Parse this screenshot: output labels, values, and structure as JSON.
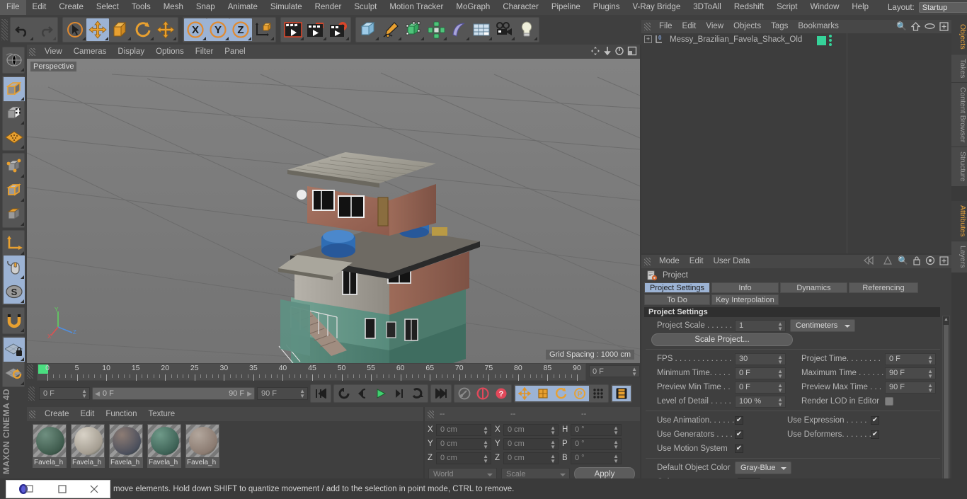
{
  "app": {
    "name": "CINEMA 4D",
    "vendor": "MAXON"
  },
  "menubar": {
    "items": [
      "File",
      "Edit",
      "Create",
      "Select",
      "Tools",
      "Mesh",
      "Snap",
      "Animate",
      "Simulate",
      "Render",
      "Sculpt",
      "Motion Tracker",
      "MoGraph",
      "Character",
      "Pipeline",
      "Plugins",
      "V-Ray Bridge",
      "3DToAll",
      "Redshift",
      "Script",
      "Window",
      "Help"
    ],
    "layout_label": "Layout:",
    "layout_value": "Startup",
    "search_icon": "search-icon"
  },
  "toolbar": {
    "groups": [
      {
        "name": "history",
        "buttons": [
          {
            "icon": "undo-icon",
            "selected": false,
            "disabled": false
          },
          {
            "icon": "redo-icon",
            "selected": false,
            "disabled": true
          }
        ]
      },
      {
        "name": "transform",
        "buttons": [
          {
            "icon": "live-selection-icon",
            "selected": false,
            "disabled": false
          },
          {
            "icon": "move-icon",
            "selected": true,
            "disabled": false
          },
          {
            "icon": "scale-icon",
            "selected": false,
            "disabled": false
          },
          {
            "icon": "rotate-icon",
            "selected": false,
            "disabled": false
          },
          {
            "icon": "move-axis-icon",
            "selected": false,
            "disabled": false
          }
        ]
      },
      {
        "name": "axis-lock",
        "buttons": [
          {
            "icon": "axis-x-icon",
            "selected": true,
            "disabled": false
          },
          {
            "icon": "axis-y-icon",
            "selected": true,
            "disabled": false
          },
          {
            "icon": "axis-z-icon",
            "selected": true,
            "disabled": false
          },
          {
            "icon": "world-coordinates-icon",
            "selected": false,
            "disabled": false
          }
        ]
      },
      {
        "name": "render",
        "buttons": [
          {
            "icon": "render-view-icon",
            "selected": false,
            "disabled": false
          },
          {
            "icon": "render-to-picture-viewer-icon",
            "selected": false,
            "disabled": false
          },
          {
            "icon": "render-settings-icon",
            "selected": false,
            "disabled": false
          }
        ]
      },
      {
        "name": "create",
        "buttons": [
          {
            "icon": "cube-primitive-icon",
            "selected": false,
            "disabled": false
          },
          {
            "icon": "spline-pen-icon",
            "selected": false,
            "disabled": false
          },
          {
            "icon": "generator-nurbs-icon",
            "selected": false,
            "disabled": false
          },
          {
            "icon": "mograph-cloner-icon",
            "selected": false,
            "disabled": false
          },
          {
            "icon": "deformer-bend-icon",
            "selected": false,
            "disabled": false
          },
          {
            "icon": "scene-floor-icon",
            "selected": false,
            "disabled": false
          },
          {
            "icon": "camera-icon",
            "selected": false,
            "disabled": false
          },
          {
            "icon": "light-icon",
            "selected": false,
            "disabled": false
          }
        ]
      }
    ]
  },
  "left_palette": {
    "groups": [
      {
        "buttons": [
          {
            "icon": "undo-view-globe-icon",
            "selected": false
          }
        ]
      },
      {
        "buttons": [
          {
            "icon": "model-mode-icon",
            "selected": true
          },
          {
            "icon": "texture-mode-icon",
            "selected": false
          },
          {
            "icon": "polygon-grid-mode-icon",
            "selected": false
          }
        ]
      },
      {
        "buttons": [
          {
            "icon": "points-mode-icon",
            "selected": false
          },
          {
            "icon": "edges-mode-icon",
            "selected": false
          },
          {
            "icon": "polygons-mode-icon",
            "selected": false
          }
        ]
      },
      {
        "buttons": [
          {
            "icon": "axis-modify-icon",
            "selected": false
          },
          {
            "icon": "viewport-solo-mouse-icon",
            "selected": true
          },
          {
            "icon": "enable-snapping-s-icon",
            "selected": true
          }
        ]
      },
      {
        "buttons": [
          {
            "icon": "magnet-tool-icon",
            "selected": false
          }
        ]
      },
      {
        "buttons": [
          {
            "icon": "workplane-lock-icon",
            "selected": true
          },
          {
            "icon": "workplane-rotate-icon",
            "selected": false
          }
        ]
      }
    ]
  },
  "viewport": {
    "menus": [
      "View",
      "Cameras",
      "Display",
      "Options",
      "Filter",
      "Panel"
    ],
    "label": "Perspective",
    "grid_spacing": "Grid Spacing : 1000 cm",
    "corner_icons": [
      "pan-view-icon",
      "dolly-view-icon",
      "rotate-view-icon",
      "maximize-view-icon"
    ],
    "axis": {
      "x": "X",
      "y": "Y",
      "z": "Z"
    },
    "background_color": "#7c7c7c",
    "grid_line_color": "#6a6a6a"
  },
  "timeline": {
    "ticks": [
      0,
      5,
      10,
      15,
      20,
      25,
      30,
      35,
      40,
      45,
      50,
      55,
      60,
      65,
      70,
      75,
      80,
      85,
      90
    ],
    "current_frame_right": "0 F",
    "current_frame": "0 F",
    "range_start": "0 F",
    "range_end": "90 F",
    "max_frame": "90 F",
    "transport": [
      {
        "icon": "go-to-start-icon",
        "selected": false
      },
      {
        "icon": "play-reverse-loop-icon",
        "selected": false
      },
      {
        "icon": "step-back-icon",
        "selected": false
      },
      {
        "icon": "play-icon",
        "selected": false
      },
      {
        "icon": "step-forward-icon",
        "selected": false
      },
      {
        "icon": "loop-icon",
        "selected": false
      },
      {
        "icon": "go-to-end-icon",
        "selected": false
      }
    ],
    "keyframe_tools": [
      {
        "icon": "record-keyframe-icon",
        "selected": false
      },
      {
        "icon": "autokeying-icon",
        "selected": false
      },
      {
        "icon": "keyframe-selection-icon",
        "selected": false
      }
    ],
    "key_param_toggles": [
      {
        "icon": "key-position-icon",
        "selected": true
      },
      {
        "icon": "key-scale-icon",
        "selected": true
      },
      {
        "icon": "key-rotation-icon",
        "selected": true
      },
      {
        "icon": "key-parameter-p-icon",
        "selected": true
      },
      {
        "icon": "key-pla-points-icon",
        "selected": false
      }
    ],
    "filmstrip": {
      "icon": "timeline-filmstrip-icon",
      "selected": true
    }
  },
  "materials": {
    "menus": [
      "Create",
      "Edit",
      "Function",
      "Texture"
    ],
    "items": [
      {
        "name": "Favela_h",
        "color_a": "#6f8f80",
        "color_b": "#3e5a4c"
      },
      {
        "name": "Favela_h",
        "color_a": "#d8d2c7",
        "color_b": "#a39c90"
      },
      {
        "name": "Favela_h",
        "color_a": "#8d7c74",
        "color_b": "#4b4f5c"
      },
      {
        "name": "Favela_h",
        "color_a": "#6f9a89",
        "color_b": "#3d6155"
      },
      {
        "name": "Favela_h",
        "color_a": "#b3a79d",
        "color_b": "#8a7a70"
      }
    ]
  },
  "coordinates": {
    "header_dashes": [
      "--",
      "--",
      "--"
    ],
    "rows": [
      {
        "pos_label": "X",
        "pos_value": "0 cm",
        "size_label": "X",
        "size_value": "0 cm",
        "rot_label": "H",
        "rot_value": "0 °"
      },
      {
        "pos_label": "Y",
        "pos_value": "0 cm",
        "size_label": "Y",
        "size_value": "0 cm",
        "rot_label": "P",
        "rot_value": "0 °"
      },
      {
        "pos_label": "Z",
        "pos_value": "0 cm",
        "size_label": "Z",
        "size_value": "0 cm",
        "rot_label": "B",
        "rot_value": "0 °"
      }
    ],
    "system": "World",
    "mode": "Scale",
    "apply": "Apply"
  },
  "object_manager": {
    "menus": [
      "File",
      "Edit",
      "View",
      "Objects",
      "Tags",
      "Bookmarks"
    ],
    "icons": [
      "search-icon",
      "home-icon",
      "ellipse-icon",
      "add-layer-icon"
    ],
    "rows": [
      {
        "name": "Messy_Brazilian_Favela_Shack_Old",
        "layer_badge": "0",
        "tag_color": "#36d39a"
      }
    ]
  },
  "attributes": {
    "menus": [
      "Mode",
      "Edit",
      "User Data"
    ],
    "icons": [
      "prev-nav-icon",
      "next-nav-icon",
      "search-icon",
      "lock-icon",
      "target-icon",
      "add-tab-icon"
    ],
    "object_title": "Project",
    "object_icon": "project-settings-icon",
    "tabs_row1": [
      {
        "label": "Project Settings",
        "active": true
      },
      {
        "label": "Info",
        "active": false
      },
      {
        "label": "Dynamics",
        "active": false
      },
      {
        "label": "Referencing",
        "active": false
      }
    ],
    "tabs_row2": [
      {
        "label": "To Do",
        "active": false
      },
      {
        "label": "Key Interpolation",
        "active": false
      }
    ],
    "section_title": "Project Settings",
    "project_scale_label": "Project Scale . . . . . .",
    "project_scale_value": "1",
    "project_units": "Centimeters",
    "scale_project_button": "Scale Project...",
    "fields": [
      {
        "label": "FPS . . . . . . . . . . . . .",
        "value": "30",
        "label2": "Project Time. . . . . . . .",
        "value2": "0 F"
      },
      {
        "label": "Minimum Time. . . . .",
        "value": "0 F",
        "label2": "Maximum Time . . . . . .",
        "value2": "90 F"
      },
      {
        "label": "Preview Min Time . .",
        "value": "0 F",
        "label2": "Preview Max Time . . .",
        "value2": "90 F"
      }
    ],
    "lod_label": "Level of Detail . . . . .",
    "lod_value": "100 %",
    "render_lod_label": "Render LOD in Editor",
    "render_lod_checked": false,
    "checks": [
      {
        "label": "Use Animation. . . . . .",
        "checked": true,
        "label2": "Use Expression . . . . .",
        "checked2": true
      },
      {
        "label": "Use Generators . . . .",
        "checked": true,
        "label2": "Use Deformers. . . . . . .",
        "checked2": true
      },
      {
        "label": "Use Motion System",
        "checked": true,
        "label2": "",
        "checked2": null
      }
    ],
    "default_color_label": "Default Object Color",
    "default_color_value": "Gray-Blue",
    "color_label": "Color . . . . . . . . . . .",
    "color_swatch": "#6e7c92"
  },
  "edge_tabs": {
    "top": [
      {
        "label": "Objects",
        "active": true
      },
      {
        "label": "Takes",
        "active": false
      },
      {
        "label": "Content Browser",
        "active": false
      },
      {
        "label": "Structure",
        "active": false
      }
    ],
    "bottom": [
      {
        "label": "Attributes",
        "active": true
      },
      {
        "label": "Layers",
        "active": false
      }
    ]
  },
  "statusbar": {
    "message": "move elements. Hold down SHIFT to quantize movement / add to the selection in point mode, CTRL to remove.",
    "taskbar_icons": [
      "app-window-icon",
      "minimize-icon",
      "close-icon"
    ]
  }
}
